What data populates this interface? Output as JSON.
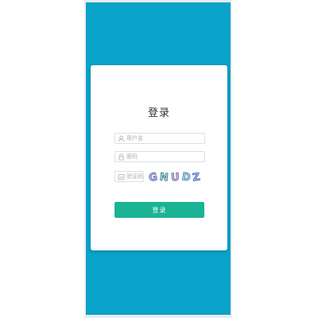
{
  "login": {
    "title": "登录",
    "username_placeholder": "用户名",
    "password_placeholder": "密码",
    "code_placeholder": "验证码",
    "captcha_text": "GNUDZ",
    "submit_label": "登录"
  },
  "colors": {
    "page_background": "#09a3c9",
    "submit_button": "#1ab394",
    "card": "#ffffff"
  },
  "icons": {
    "username": "user-icon",
    "password": "lock-icon",
    "code": "shield-icon"
  }
}
